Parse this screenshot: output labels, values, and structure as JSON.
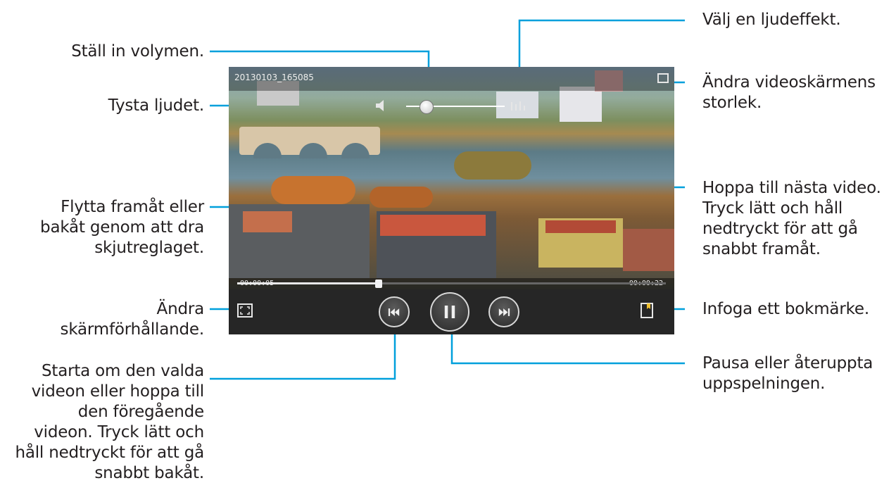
{
  "callouts_left": {
    "volume": "Ställ in volymen.",
    "mute": "Tysta ljudet.",
    "seek": "Flytta framåt eller\nbakåt genom att dra\nskjutreglaget.",
    "aspect": "Ändra\nskärmförhållande.",
    "previous": "Starta om den valda\nvideon eller hoppa till\nden föregående\nvideon. Tryck lätt och\nhåll nedtryckt för att gå\nsnabbt bakåt."
  },
  "callouts_right": {
    "effect": "Välj en ljudeffekt.",
    "resize": "Ändra videoskärmens\nstorlek.",
    "next": "Hoppa till nästa video.\nTryck lätt och håll\nnedtryckt för att gå\nsnabbt framåt.",
    "bookmark": "Infoga ett bokmärke.",
    "pause": "Pausa eller återuppta\nuppspelningen."
  },
  "player": {
    "file_title": "20130103_165085",
    "elapsed": "00:00:05",
    "total": "00:00:22",
    "progress": 0.33,
    "volume_level": 0.2
  },
  "icons": {
    "mute": "speaker-icon",
    "effect": "sound-effect-icon",
    "resize": "resize-screen-icon",
    "aspect": "aspect-ratio-icon",
    "previous": "previous-track-icon",
    "pause": "pause-icon",
    "next": "next-track-icon",
    "bookmark": "bookmark-icon"
  },
  "colors": {
    "leader": "#00a0dc",
    "text": "#231f20",
    "controls_bg": "#262626"
  }
}
